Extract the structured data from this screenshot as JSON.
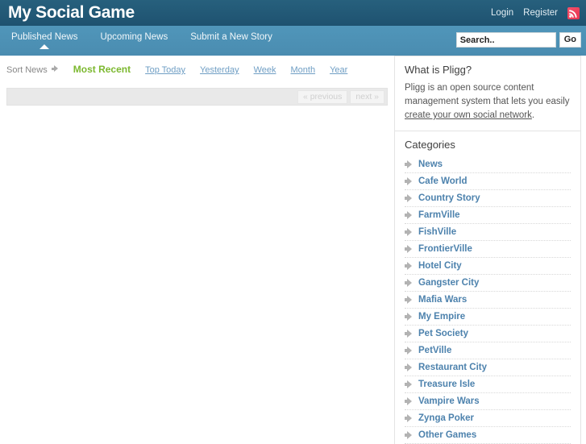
{
  "header": {
    "site_title": "My Social Game",
    "login_label": "Login",
    "register_label": "Register",
    "rss_icon": "rss-icon",
    "colors": {
      "topbar": "#225a77",
      "navbar": "#4b91b6",
      "rss": "#e8344f",
      "active_sort": "#7cb82f",
      "category_link": "#4d82ad"
    }
  },
  "nav": {
    "items": [
      {
        "label": "Published News",
        "active": true
      },
      {
        "label": "Upcoming News",
        "active": false
      },
      {
        "label": "Submit a New Story",
        "active": false
      }
    ]
  },
  "search": {
    "value": "Search..",
    "placeholder": "Search..",
    "go_label": "Go"
  },
  "sort": {
    "label": "Sort News",
    "arrow_icon": "right-arrow-icon",
    "options": [
      {
        "label": "Most Recent",
        "active": true
      },
      {
        "label": "Top Today",
        "active": false
      },
      {
        "label": "Yesterday",
        "active": false
      },
      {
        "label": "Week",
        "active": false
      },
      {
        "label": "Month",
        "active": false
      },
      {
        "label": "Year",
        "active": false
      }
    ]
  },
  "pagination": {
    "previous_label": "« previous",
    "next_label": "next »"
  },
  "sidebar": {
    "about": {
      "title": "What is Pligg?",
      "text_before": "Pligg is an open source content management system that lets you easily ",
      "link_text": "create your own social network",
      "text_after": "."
    },
    "categories": {
      "title": "Categories",
      "bullet_icon": "right-arrow-bullet-icon",
      "items": [
        {
          "label": "News"
        },
        {
          "label": "Cafe World"
        },
        {
          "label": "Country Story"
        },
        {
          "label": "FarmVille"
        },
        {
          "label": "FishVille"
        },
        {
          "label": "FrontierVille"
        },
        {
          "label": "Hotel City"
        },
        {
          "label": "Gangster City"
        },
        {
          "label": "Mafia Wars"
        },
        {
          "label": "My Empire"
        },
        {
          "label": "Pet Society"
        },
        {
          "label": "PetVille"
        },
        {
          "label": "Restaurant City"
        },
        {
          "label": "Treasure Isle"
        },
        {
          "label": "Vampire Wars"
        },
        {
          "label": "Zynga Poker"
        },
        {
          "label": "Other Games"
        }
      ]
    }
  }
}
